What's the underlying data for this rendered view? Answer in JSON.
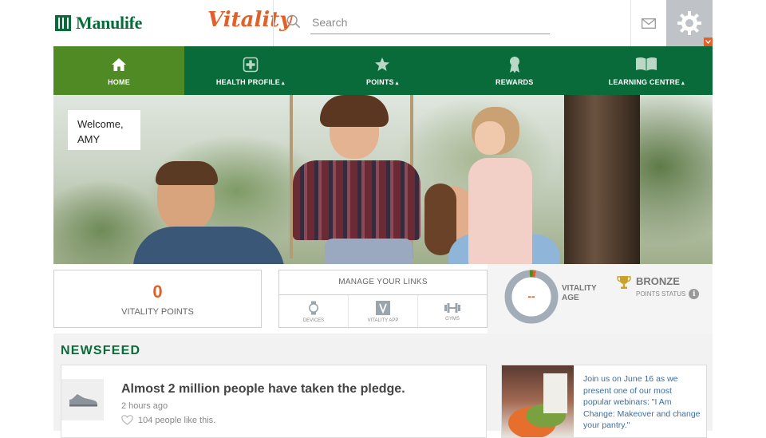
{
  "header": {
    "brand": "Manulife",
    "program_logo": "Vitality",
    "search": {
      "placeholder": "Search",
      "value": ""
    },
    "mail_icon": "envelope-icon",
    "settings_icon": "gear-icon"
  },
  "nav": {
    "items": [
      {
        "label": "HOME",
        "icon": "home-icon",
        "active": true,
        "caret": ""
      },
      {
        "label": "HEALTH PROFILE",
        "icon": "health-plus-icon",
        "active": false,
        "caret": "▴"
      },
      {
        "label": "POINTS",
        "icon": "star-icon",
        "active": false,
        "caret": "▴"
      },
      {
        "label": "REWARDS",
        "icon": "ribbon-icon",
        "active": false,
        "caret": ""
      },
      {
        "label": "LEARNING CENTRE",
        "icon": "book-icon",
        "active": false,
        "caret": "▴"
      }
    ]
  },
  "hero": {
    "welcome_line": "Welcome,",
    "user_name": "AMY"
  },
  "summary": {
    "points_value": "0",
    "points_label": "VITALITY POINTS",
    "links_title": "MANAGE YOUR LINKS",
    "links": [
      {
        "label": "DEVICES",
        "icon": "watch-icon"
      },
      {
        "label": "VITALITY APP",
        "icon": "vitality-app-icon"
      },
      {
        "label": "GYMS",
        "icon": "dumbbell-icon"
      }
    ],
    "age_value": "--",
    "age_label_line1": "VITALITY",
    "age_label_line2": "AGE",
    "status_title": "BRONZE",
    "status_sub": "POINTS STATUS",
    "status_icon": "trophy-icon"
  },
  "newsfeed": {
    "heading": "NEWSFEED",
    "post": {
      "title": "Almost 2 million people have taken the pledge.",
      "time": "2 hours ago",
      "likes": "104 people like this.",
      "thumb_icon": "sneaker-icon"
    },
    "promo": {
      "text": "Join us on June 16 as we present one of our most popular webinars: \"I Am Change: Makeover and change your pantry.\""
    }
  },
  "colors": {
    "brand_green": "#0a6b3a",
    "active_green": "#4f8a24",
    "accent_orange": "#e1612a"
  }
}
